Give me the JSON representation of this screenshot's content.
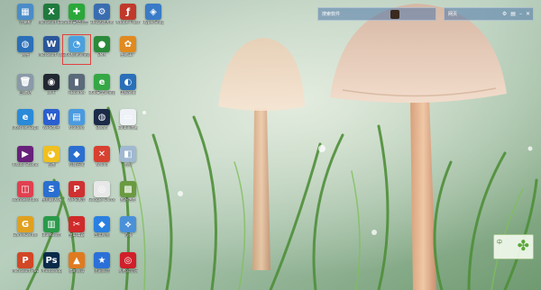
{
  "desktop": {
    "icons": [
      {
        "label": "计算机",
        "color": "#4a8cc8",
        "glyph": "▦"
      },
      {
        "label": "Microsoft Excel",
        "color": "#1f7a3d",
        "glyph": "X"
      },
      {
        "label": "360安全卫士",
        "color": "#2aa83a",
        "glyph": "✚"
      },
      {
        "label": "360驱动大师",
        "color": "#3a6db0",
        "glyph": "⚙"
      },
      {
        "label": "Adobe Flash",
        "color": "#c0392b",
        "glyph": "ƒ"
      },
      {
        "label": "HyperSnap",
        "color": "#3a7bc8",
        "glyph": "◈"
      },
      {
        "label": "网络",
        "color": "#2a6fb8",
        "glyph": "◍"
      },
      {
        "label": "Microsoft Word",
        "color": "#2b579a",
        "glyph": "W"
      },
      {
        "label": "360极速浏览器",
        "color": "#4aa0e0",
        "glyph": "◔"
      },
      {
        "label": "SMM",
        "color": "#2a8a3a",
        "glyph": "●"
      },
      {
        "label": "格式工厂",
        "color": "#e08a20",
        "glyph": "✿"
      },
      {
        "label": "回收站",
        "color": "#8a9aa8",
        "glyph": "🗑"
      },
      {
        "label": "Wi-Fi",
        "color": "#222831",
        "glyph": "◉"
      },
      {
        "label": "HBuilder",
        "color": "#5a6a7a",
        "glyph": "▮"
      },
      {
        "label": "360安全浏览器",
        "color": "#35a845",
        "glyph": "e"
      },
      {
        "label": "电脑管家",
        "color": "#2a6fb8",
        "glyph": "◐"
      },
      {
        "label": "Internet Explorer",
        "color": "#2a8ad8",
        "glyph": "e"
      },
      {
        "label": "WPS文字",
        "color": "#2a5fd0",
        "glyph": "W"
      },
      {
        "label": "Xfolders",
        "color": "#4a9ae0",
        "glyph": "▤"
      },
      {
        "label": "Steam",
        "color": "#1a2a48",
        "glyph": "◍"
      },
      {
        "label": "Bilibili弹幕",
        "color": "#eef2f6",
        "glyph": "▭"
      },
      {
        "label": "Visual Studio",
        "color": "#68217a",
        "glyph": "▶"
      },
      {
        "label": "画图",
        "color": "#f0c020",
        "glyph": "◕"
      },
      {
        "label": "万能五笔",
        "color": "#2a6fd0",
        "glyph": "◆"
      },
      {
        "label": "Xmind",
        "color": "#d84030",
        "glyph": "✕"
      },
      {
        "label": "图标",
        "color": "#a0b8d0",
        "glyph": "◧"
      },
      {
        "label": "Wondershare",
        "color": "#e04050",
        "glyph": "◫"
      },
      {
        "label": "搜狗输入法",
        "color": "#2a6fd0",
        "glyph": "S"
      },
      {
        "label": "WPS演示",
        "color": "#d03030",
        "glyph": "P"
      },
      {
        "label": "Google Chrome",
        "color": "#e8e8e8",
        "glyph": "◎"
      },
      {
        "label": "我的世界",
        "color": "#6a9a40",
        "glyph": "▩"
      },
      {
        "label": "GameCenter",
        "color": "#e0a020",
        "glyph": "G"
      },
      {
        "label": "Bluetooth",
        "color": "#2a9a4a",
        "glyph": "▥"
      },
      {
        "label": "金山毒霸",
        "color": "#d02a2a",
        "glyph": "✂"
      },
      {
        "label": "百度网盘",
        "color": "#2a80e0",
        "glyph": "◆"
      },
      {
        "label": "迅雷",
        "color": "#4a90d8",
        "glyph": "⟡"
      },
      {
        "label": "Microsoft PowerPoint",
        "color": "#d24726",
        "glyph": "P"
      },
      {
        "label": "Photoshop",
        "color": "#0a2a4a",
        "glyph": "Ps"
      },
      {
        "label": "福昕阅读",
        "color": "#e07a20",
        "glyph": "▲"
      },
      {
        "label": "迅雷影音",
        "color": "#2a70d8",
        "glyph": "★"
      },
      {
        "label": "网易云音乐",
        "color": "#d0202a",
        "glyph": "◎"
      }
    ]
  },
  "search_widget": {
    "label": "搜索软件"
  },
  "browser_bar": {
    "text": "网页"
  },
  "weather_widget": {
    "text": "中"
  }
}
